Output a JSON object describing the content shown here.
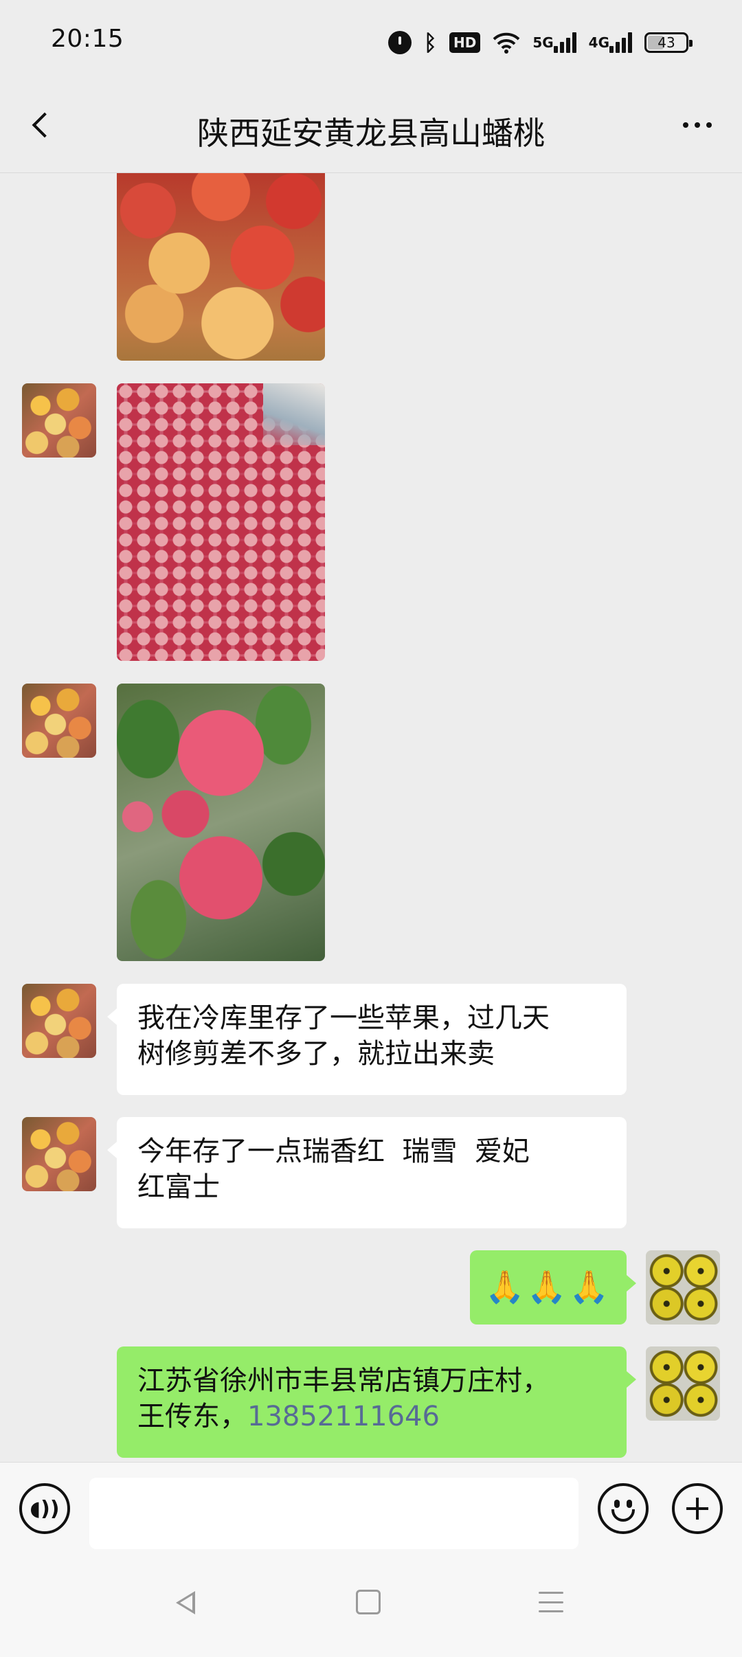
{
  "status_bar": {
    "time": "20:15",
    "icons": [
      "alarm-icon",
      "bluetooth-icon",
      "hd-icon",
      "wifi-icon",
      "5g-signal-icon",
      "4g-signal-icon",
      "battery-icon"
    ],
    "hd_label": "HD",
    "net_5g": "5G",
    "net_4g": "4G",
    "battery_level": "43"
  },
  "header": {
    "title": "陕西延安黄龙县高山蟠桃"
  },
  "messages": [
    {
      "type": "image",
      "direction": "incoming",
      "content": "apples-in-basket-photo"
    },
    {
      "type": "image",
      "direction": "incoming",
      "content": "apple-pile-photo"
    },
    {
      "type": "image",
      "direction": "incoming",
      "content": "apples-on-tree-photo"
    },
    {
      "type": "text",
      "direction": "incoming",
      "lines": [
        "我在冷库里存了一些苹果，过几天",
        "树修剪差不多了，就拉出来卖"
      ]
    },
    {
      "type": "text",
      "direction": "incoming",
      "lines": [
        "今年存了一点瑞香红  瑞雪  爱妃",
        "红富士"
      ]
    },
    {
      "type": "emoji",
      "direction": "outgoing",
      "text": "🙏🙏🙏"
    },
    {
      "type": "text",
      "direction": "outgoing",
      "line1": "江苏省徐州市丰县常店镇万庄村，",
      "line2_prefix": "王传东，",
      "phone": "13852111646"
    }
  ],
  "input_bar": {
    "placeholder": "",
    "icons": [
      "voice-icon",
      "emoji-icon",
      "plus-icon"
    ]
  },
  "colors": {
    "background": "#ededed",
    "incoming_bubble": "#ffffff",
    "outgoing_bubble": "#95ec69",
    "link": "#576b95"
  }
}
